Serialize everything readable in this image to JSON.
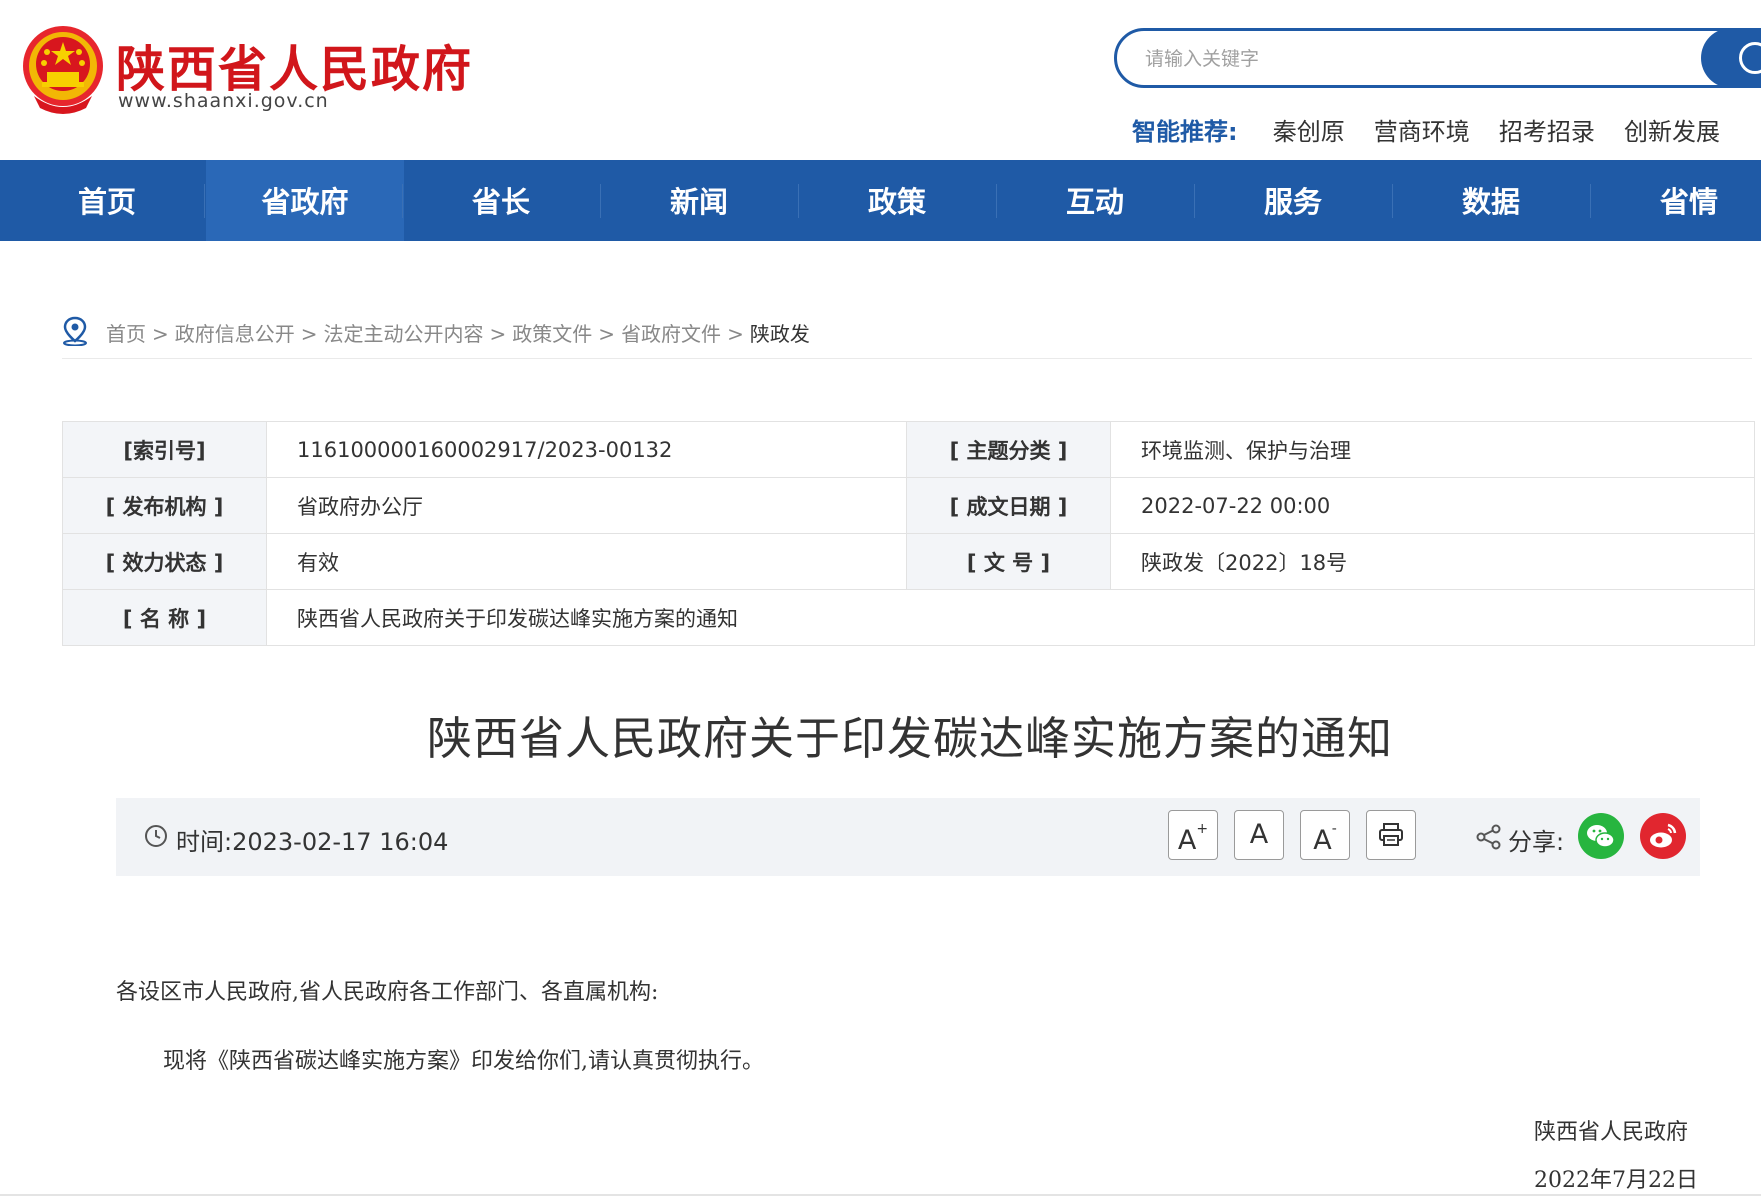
{
  "header": {
    "site_title": "陕西省人民政府",
    "site_url": "www.shaanxi.gov.cn",
    "search": {
      "placeholder": "请输入关键字"
    },
    "recommend": {
      "label": "智能推荐:",
      "items": [
        "秦创原",
        "营商环境",
        "招考招录",
        "创新发展"
      ]
    }
  },
  "nav": {
    "items": [
      "首页",
      "省政府",
      "省长",
      "新闻",
      "政策",
      "互动",
      "服务",
      "数据",
      "省情"
    ],
    "active_index": 1
  },
  "breadcrumb": {
    "items": [
      "首页",
      "政府信息公开",
      "法定主动公开内容",
      "政策文件",
      "省政府文件"
    ],
    "separator": ">",
    "current": "陕政发"
  },
  "meta": {
    "index_no_label": "[索引号]",
    "index_no": "11610000016000291​7/2023-00132",
    "topic_label": "[ 主题分类 ]",
    "topic": "环境监测、保护与治理",
    "publisher_label": "[ 发布机构 ]",
    "publisher": "省政府办公厅",
    "date_label": "[ 成文日期 ]",
    "date": "2022-07-22 00:00",
    "status_label": "[ 效力状态 ]",
    "status": "有效",
    "doc_no_label": "[ 文 号 ]",
    "doc_no": "陕政发〔2022〕18号",
    "name_label": "[ 名 称 ]",
    "name": "陕西省人民政府关于印发碳达峰实施方案的通知"
  },
  "article": {
    "title": "陕西省人民政府关于印发碳达峰实施方案的通知",
    "time_label": "时间:",
    "time": "2023-02-17 16:04",
    "font_large": "A",
    "font_large_sup": "+",
    "font_normal": "A",
    "font_small": "A",
    "font_small_sup": "-",
    "share_label": "分享:",
    "salutation": "各设区市人民政府,省人民政府各工作部门、各直属机构:",
    "paragraph": "现将《陕西省碳达峰实施方案》印发给你们,请认真贯彻执行。",
    "signature": "陕西省人民政府",
    "sign_date": "2022年7月22日"
  },
  "colors": {
    "brand_red": "#d1161b",
    "nav_blue": "#1f5aa6",
    "wechat_green": "#27b53f",
    "weibo_red": "#e1262f"
  }
}
